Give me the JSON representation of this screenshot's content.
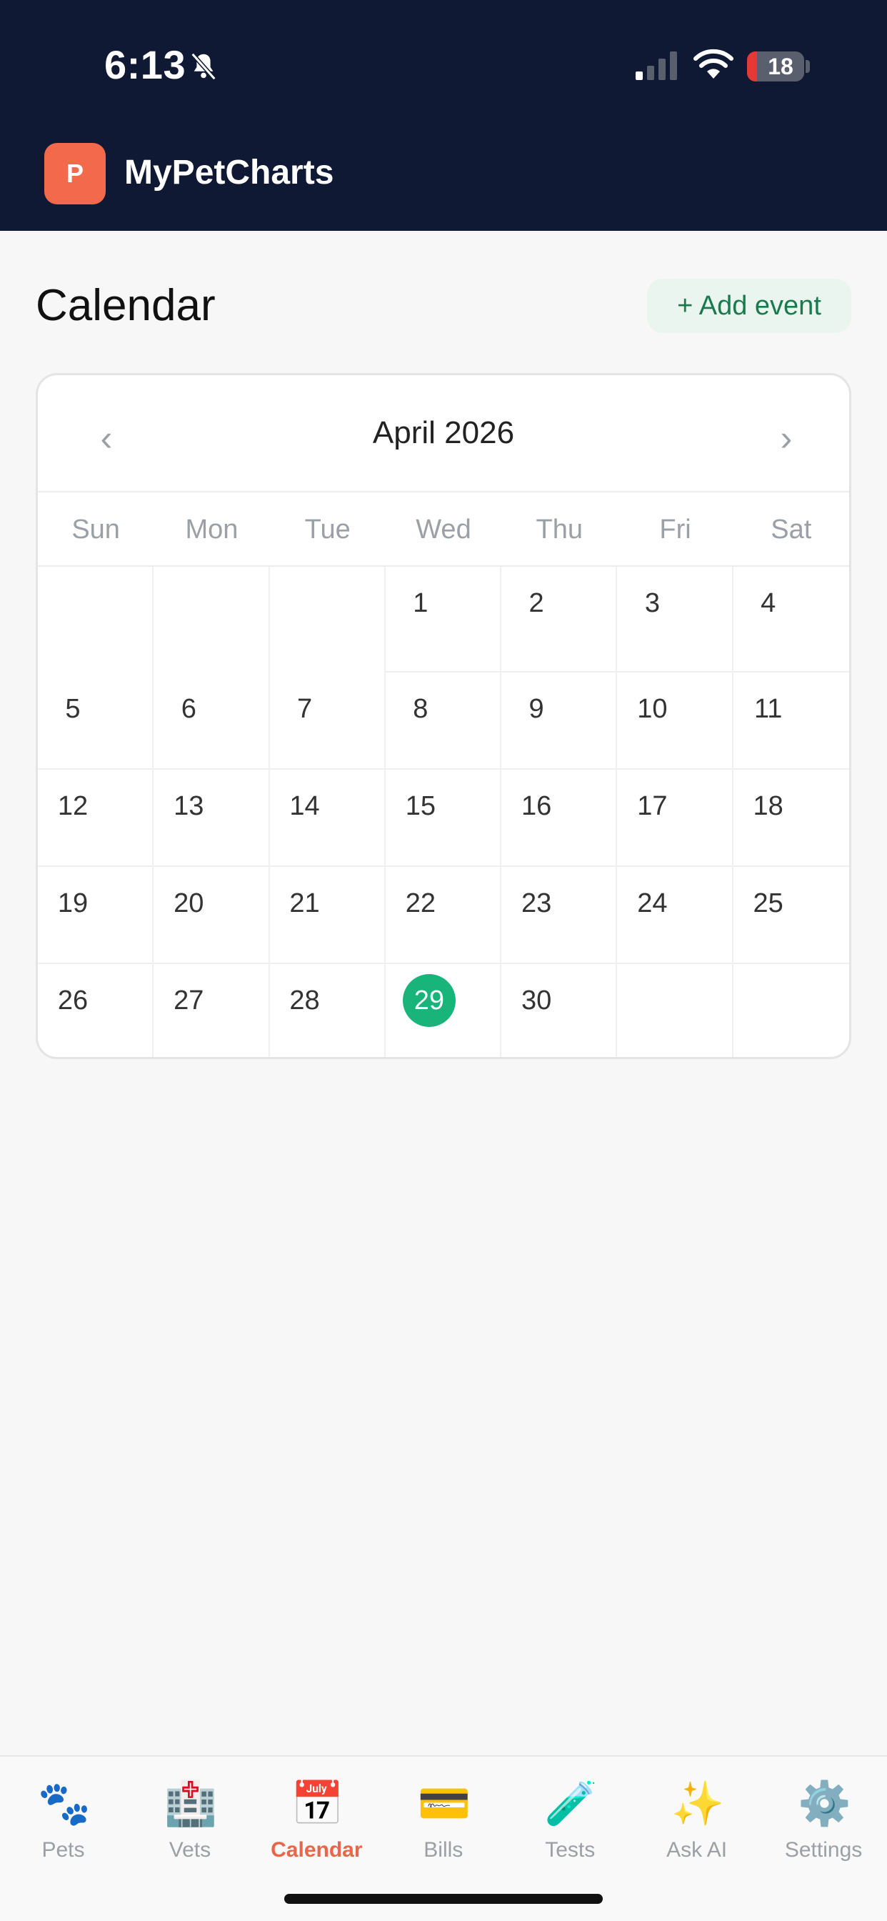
{
  "status_bar": {
    "time": "6:13",
    "battery_level": "18",
    "battery_fraction": 0.18
  },
  "app": {
    "logo_letter": "P",
    "name": "MyPetCharts"
  },
  "page": {
    "title": "Calendar",
    "add_event_label": "+ Add event"
  },
  "calendar": {
    "prev_label": "‹",
    "next_label": "›",
    "month_label": "April 2026",
    "weekdays": [
      "Sun",
      "Mon",
      "Tue",
      "Wed",
      "Thu",
      "Fri",
      "Sat"
    ],
    "weeks": [
      [
        "",
        "",
        "",
        "1",
        "2",
        "3",
        "4"
      ],
      [
        "5",
        "6",
        "7",
        "8",
        "9",
        "10",
        "11"
      ],
      [
        "12",
        "13",
        "14",
        "15",
        "16",
        "17",
        "18"
      ],
      [
        "19",
        "20",
        "21",
        "22",
        "23",
        "24",
        "25"
      ],
      [
        "26",
        "27",
        "28",
        "29",
        "30",
        "",
        ""
      ]
    ],
    "today": "29",
    "accent_color": "#18b47a"
  },
  "tabbar": {
    "active": "Calendar",
    "accent_color": "#e8674a",
    "tabs": [
      {
        "label": "Pets",
        "icon": "paw-prints-icon",
        "glyph": "🐾"
      },
      {
        "label": "Vets",
        "icon": "hospital-icon",
        "glyph": "🏥"
      },
      {
        "label": "Calendar",
        "icon": "calendar-icon",
        "glyph": "📅"
      },
      {
        "label": "Bills",
        "icon": "credit-card-icon",
        "glyph": "💳"
      },
      {
        "label": "Tests",
        "icon": "test-tube-icon",
        "glyph": "🧪"
      },
      {
        "label": "Ask AI",
        "icon": "sparkles-icon",
        "glyph": "✨"
      },
      {
        "label": "Settings",
        "icon": "gear-icon",
        "glyph": "⚙️"
      }
    ]
  }
}
